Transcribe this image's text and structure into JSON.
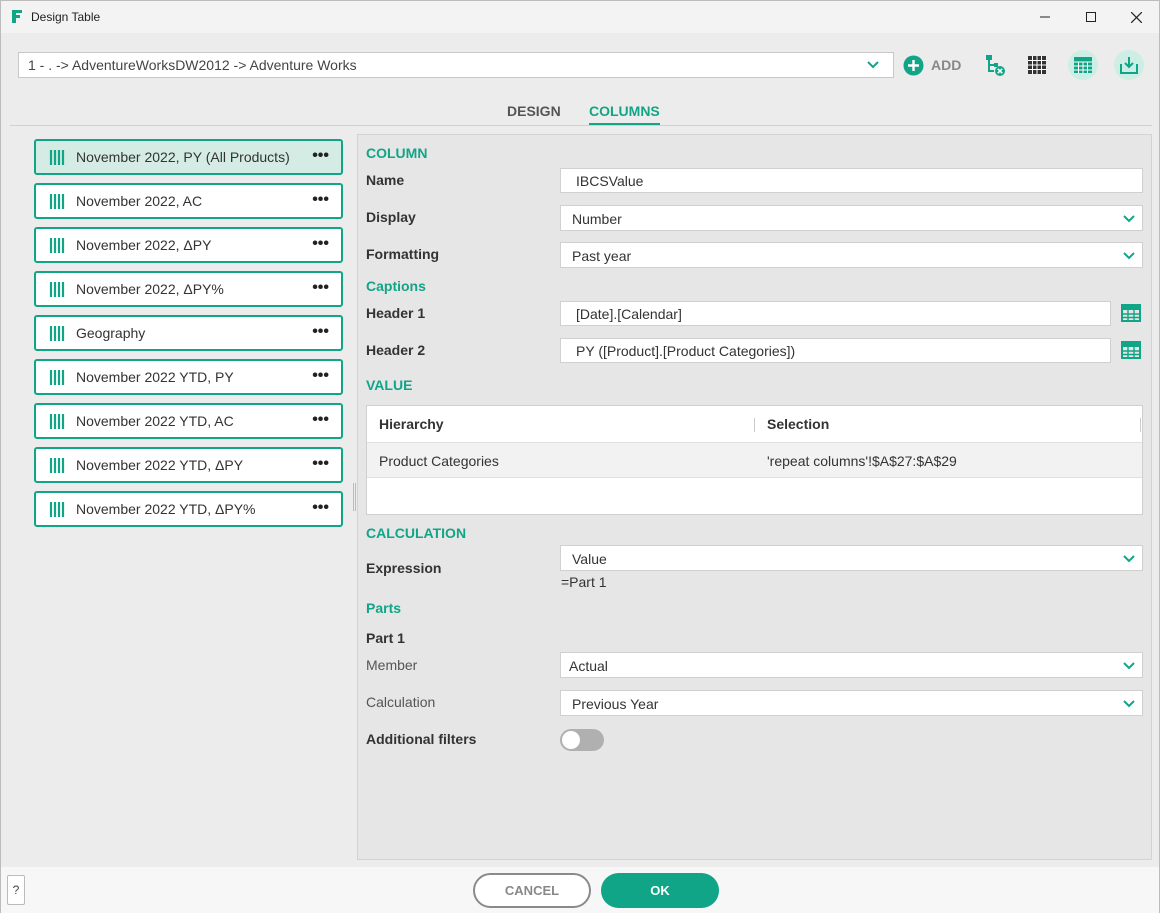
{
  "window": {
    "title": "Design Table"
  },
  "toolbar": {
    "path_value": "1 - . -> AdventureWorksDW2012 -> Adventure Works",
    "add_label": "ADD"
  },
  "tabs": [
    {
      "label": "DESIGN",
      "active": false
    },
    {
      "label": "COLUMNS",
      "active": true
    }
  ],
  "columns_list": [
    {
      "label": "November 2022, PY (All Products)",
      "selected": true
    },
    {
      "label": "November 2022, AC",
      "selected": false
    },
    {
      "label": "November 2022, ΔPY",
      "selected": false
    },
    {
      "label": "November 2022, ΔPY%",
      "selected": false
    },
    {
      "label": "Geography",
      "selected": false
    },
    {
      "label": "November 2022 YTD, PY",
      "selected": false
    },
    {
      "label": "November 2022 YTD, AC",
      "selected": false
    },
    {
      "label": "November 2022 YTD, ΔPY",
      "selected": false
    },
    {
      "label": "November 2022 YTD, ΔPY%",
      "selected": false
    }
  ],
  "more_glyph": "•••",
  "column": {
    "section": "COLUMN",
    "name_label": "Name",
    "name_value": "IBCSValue",
    "display_label": "Display",
    "display_value": "Number",
    "formatting_label": "Formatting",
    "formatting_value": "Past year"
  },
  "captions": {
    "section": "Captions",
    "header1_label": "Header 1",
    "header1_value": "[Date].[Calendar]",
    "header2_label": "Header 2",
    "header2_value": "PY ([Product].[Product Categories])"
  },
  "value": {
    "section": "VALUE",
    "headers": [
      "Hierarchy",
      "Selection"
    ],
    "rows": [
      {
        "hierarchy": "Product Categories",
        "selection": "'repeat columns'!$A$27:$A$29"
      }
    ]
  },
  "calculation": {
    "section": "CALCULATION",
    "expression_label": "Expression",
    "expression_value": "Value",
    "expression_formula": "=Part 1"
  },
  "parts": {
    "section": "Parts",
    "part_title": "Part 1",
    "member_label": "Member",
    "member_value": "Actual",
    "calculation_label": "Calculation",
    "calculation_value": "Previous Year",
    "additional_filters_label": "Additional filters",
    "additional_filters_on": false
  },
  "footer": {
    "help_label": "?",
    "cancel_label": "CANCEL",
    "ok_label": "OK"
  },
  "colors": {
    "accent": "#11a587",
    "selected_item_bg": "#d4ece4"
  }
}
